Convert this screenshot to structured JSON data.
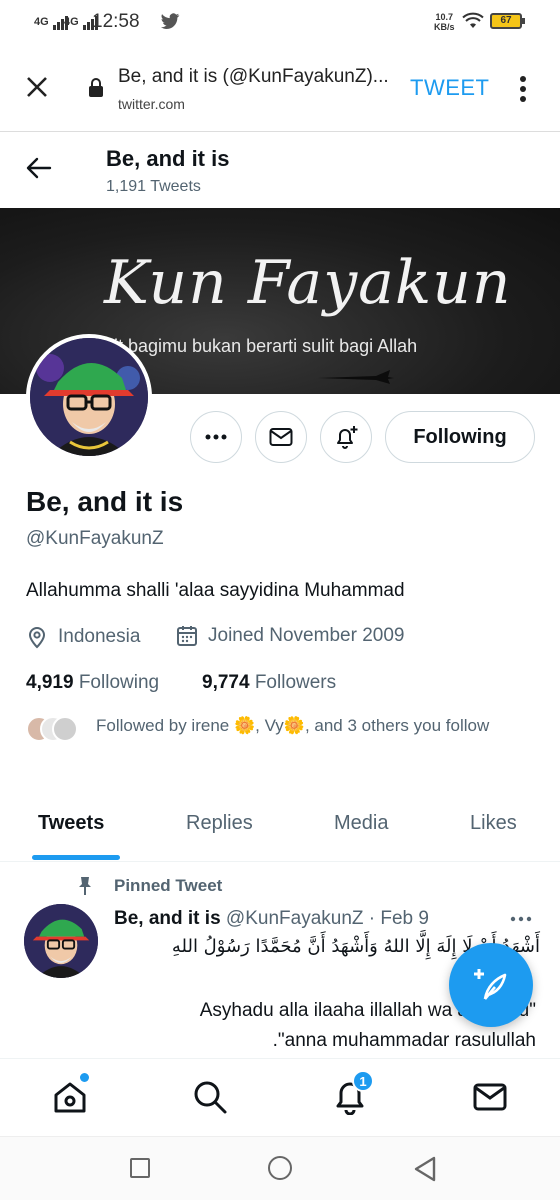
{
  "status_bar": {
    "network1": "4G",
    "network2": "4G",
    "time": "12:58",
    "speed_value": "10.7",
    "speed_unit": "KB/s",
    "battery": "67"
  },
  "browser": {
    "page_title": "Be, and it is (@KunFayakunZ)...",
    "domain": "twitter.com",
    "tweet_button": "TWEET"
  },
  "profile_header": {
    "name": "Be, and it is",
    "tweets_count": "1,191 Tweets"
  },
  "banner": {
    "title": "Kun Fayakun",
    "subtitle": "lit bagimu bukan berarti sulit bagi Allah"
  },
  "actions": {
    "following_label": "Following"
  },
  "profile": {
    "display_name": "Be, and it is",
    "handle": "@KunFayakunZ",
    "bio": "Allahumma shalli 'alaa sayyidina Muhammad",
    "location": "Indonesia",
    "joined": "Joined November 2009",
    "following_count": "4,919",
    "following_label": "Following",
    "followers_count": "9,774",
    "followers_label": "Followers",
    "followed_by": "Followed by irene 🌼, Vy🌼, and 3 others you follow"
  },
  "tabs": [
    "Tweets",
    "Replies",
    "Media",
    "Likes"
  ],
  "pinned_tweet": {
    "pinned_label": "Pinned Tweet",
    "author_name": "Be, and it is",
    "author_handle": "@KunFayakunZ",
    "date": "· Feb 9",
    "arabic_text": "أَشْهَدُ أَنْ لَا إِلَهَ إِلَّا اللهُ وَأَشْهَدُ أَنَّ مُحَمَّدًا رَسُوْلُ اللهِ",
    "line1": "Asyhadu alla ilaaha illallah wa asyhadu\"",
    "line2": ".\"anna muhammadar rasulullah"
  },
  "bottom_nav": {
    "notification_badge": "1"
  },
  "colors": {
    "accent": "#1d9bf0",
    "text_primary": "#0f1419",
    "text_secondary": "#536471"
  }
}
